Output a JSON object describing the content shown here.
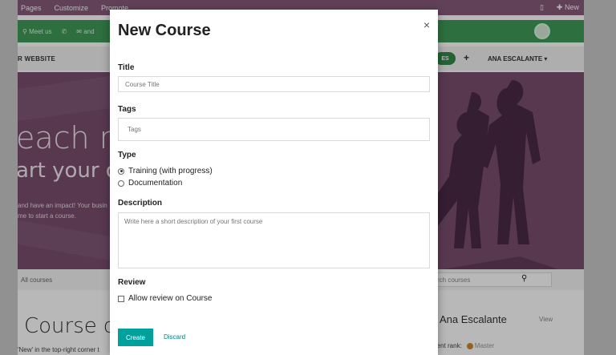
{
  "topbar": {
    "menu": [
      "Pages",
      "Customize",
      "Promote"
    ],
    "new_label": "New",
    "new_icon": "plus-icon",
    "device_icon": "mobile-icon"
  },
  "greenbar": {
    "items": [
      "Meet us",
      "and"
    ]
  },
  "navbar": {
    "brand": "R WEBSITE",
    "pill_label": "ES",
    "plus": "+",
    "user": "ANA ESCALANTE"
  },
  "hero": {
    "line1": "each ne",
    "line2": "art your on",
    "para1": "and have an impact! Your busin",
    "para2": "me to start a course."
  },
  "filterbar": {
    "all_courses": "All courses",
    "search_placeholder": "rch courses"
  },
  "background_bottom": {
    "title": "Course cr",
    "note": "'New' in the top-right corner t",
    "user_name": "Ana Escalante",
    "view": "View",
    "rank_label": "ment rank:",
    "rank_value": "Master"
  },
  "modal": {
    "title": "New Course",
    "close": "×",
    "title_label": "Title",
    "title_placeholder": "Course Title",
    "tags_label": "Tags",
    "tags_placeholder": "Tags",
    "type_label": "Type",
    "type_options": [
      "Training (with progress)",
      "Documentation"
    ],
    "type_selected": "Training (with progress)",
    "description_label": "Description",
    "description_placeholder": "Write here a short description of your first course",
    "review_label": "Review",
    "review_option": "Allow review on Course",
    "review_checked": false,
    "create_button": "Create",
    "discard_button": "Discard"
  },
  "colors": {
    "brand_purple": "#875a7b",
    "primary_teal": "#00a09d",
    "green_bar": "#3f9a57"
  }
}
